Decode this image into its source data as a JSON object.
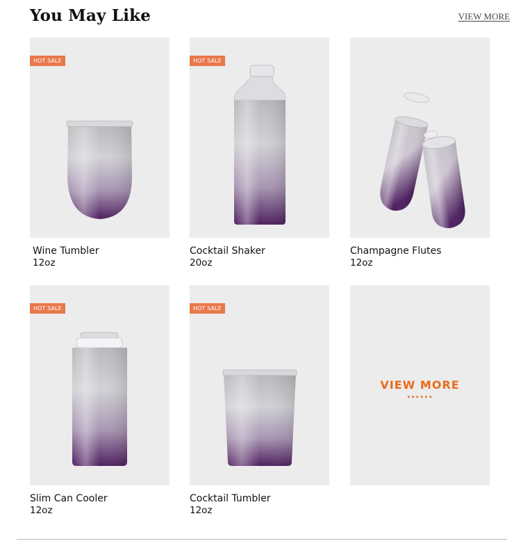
{
  "header": {
    "title": "You May Like",
    "view_more_link": "VIEW MORE"
  },
  "products": [
    {
      "name": "Wine Tumbler",
      "size": "12oz",
      "badge": "HOT SALE",
      "image_icon": "wine-tumbler-icon"
    },
    {
      "name": "Cocktail Shaker",
      "size": "20oz",
      "badge": "HOT SALE",
      "image_icon": "cocktail-shaker-icon"
    },
    {
      "name": "Champagne Flutes",
      "size": "12oz",
      "badge": "",
      "image_icon": "champagne-flutes-icon"
    },
    {
      "name": "Slim Can Cooler",
      "size": "12oz",
      "badge": "HOT SALE",
      "image_icon": "slim-can-cooler-icon"
    },
    {
      "name": "Cocktail Tumbler",
      "size": "12oz",
      "badge": "HOT SALE",
      "image_icon": "cocktail-tumbler-icon"
    }
  ],
  "view_more_tile": {
    "label": "VIEW MORE",
    "dots": "......"
  },
  "colors": {
    "badge_bg": "#e8784a",
    "accent_orange": "#e96b1b",
    "tile_bg": "#ececec",
    "gradient_silver": "#c8c8cc",
    "gradient_purple": "#5a2a6a"
  }
}
